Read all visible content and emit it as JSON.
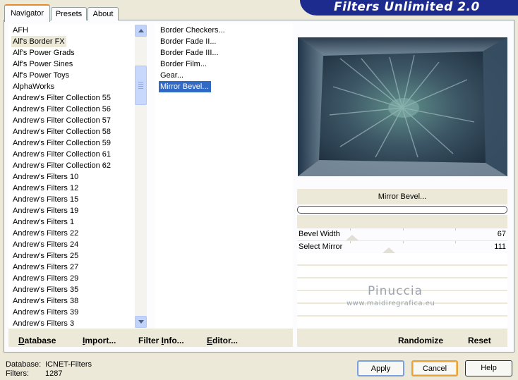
{
  "tabs": [
    {
      "label": "Navigator",
      "active": true
    },
    {
      "label": "Presets",
      "active": false
    },
    {
      "label": "About",
      "active": false
    }
  ],
  "banner": {
    "title": "Filters Unlimited 2.0"
  },
  "categories": {
    "selected_index": 1,
    "items": [
      "AFH",
      "Alf's Border FX",
      "Alf's Power Grads",
      "Alf's Power Sines",
      "Alf's Power Toys",
      "AlphaWorks",
      "Andrew's Filter Collection 55",
      "Andrew's Filter Collection 56",
      "Andrew's Filter Collection 57",
      "Andrew's Filter Collection 58",
      "Andrew's Filter Collection 59",
      "Andrew's Filter Collection 61",
      "Andrew's Filter Collection 62",
      "Andrew's Filters 10",
      "Andrew's Filters 12",
      "Andrew's Filters 15",
      "Andrew's Filters 19",
      "Andrew's Filters 1",
      "Andrew's Filters 22",
      "Andrew's Filters 24",
      "Andrew's Filters 25",
      "Andrew's Filters 27",
      "Andrew's Filters 29",
      "Andrew's Filters 35",
      "Andrew's Filters 38",
      "Andrew's Filters 39",
      "Andrew's Filters 3"
    ]
  },
  "filters": {
    "selected_index": 5,
    "items": [
      "Border Checkers...",
      "Border Fade II...",
      "Border Fade III...",
      "Border Film...",
      "Gear...",
      "Mirror Bevel..."
    ]
  },
  "preview": {
    "filter_name": "Mirror Bevel..."
  },
  "params": [
    {
      "name": "Bevel Width",
      "value": "67",
      "fraction": 0.263
    },
    {
      "name": "Select Mirror",
      "value": "111",
      "fraction": 0.435
    }
  ],
  "watermark": {
    "name": "Pinuccia",
    "site": "www.maidiregrafica.eu"
  },
  "bottom_buttons": {
    "database": {
      "label": "Database",
      "underline": "D",
      "rest": "atabase"
    },
    "import": {
      "label": "Import...",
      "underline": "I",
      "rest": "mport..."
    },
    "filter_info": {
      "pre": "Filter ",
      "underline": "I",
      "rest": "nfo..."
    },
    "editor": {
      "underline": "E",
      "rest": "ditor..."
    },
    "randomize": "Randomize",
    "reset": "Reset"
  },
  "status": {
    "database_label": "Database:",
    "database_value": "ICNET-Filters",
    "filters_label": "Filters:",
    "filters_value": "1287"
  },
  "dialog_buttons": {
    "apply": "Apply",
    "cancel": "Cancel",
    "help": "Help"
  }
}
